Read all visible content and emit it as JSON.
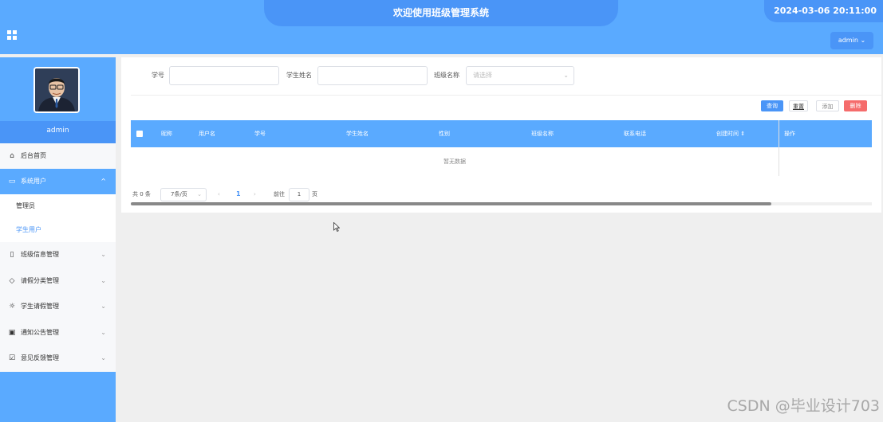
{
  "header": {
    "title": "欢迎使用班级管理系统",
    "datetime": "2024-03-06 20:11:00",
    "user_button": "admin",
    "menu_icon": "grid-icon"
  },
  "sidebar": {
    "username": "admin",
    "items": [
      {
        "label": "后台首页",
        "icon": "home-icon",
        "active": false
      },
      {
        "label": "系统用户",
        "icon": "monitor-icon",
        "active": true,
        "expanded": true,
        "children": [
          {
            "label": "管理员",
            "active": false
          },
          {
            "label": "学生用户",
            "active": true
          }
        ]
      },
      {
        "label": "班级信息管理",
        "icon": "bookmark-icon"
      },
      {
        "label": "请假分类管理",
        "icon": "tag-icon"
      },
      {
        "label": "学生请假管理",
        "icon": "sun-icon"
      },
      {
        "label": "通知公告管理",
        "icon": "inbox-icon"
      },
      {
        "label": "意见反馈管理",
        "icon": "clipboard-icon"
      }
    ]
  },
  "search": {
    "student_no_label": "学号",
    "student_no_value": "",
    "student_name_label": "学生姓名",
    "student_name_value": "",
    "class_label": "班级名称",
    "class_placeholder": "请选择"
  },
  "actions": {
    "query": "查询",
    "reset": "重置",
    "add": "添加",
    "delete": "删除"
  },
  "table": {
    "columns": [
      "昵称",
      "用户名",
      "学号",
      "学生姓名",
      "性别",
      "班级名称",
      "联系电话",
      "创建时间"
    ],
    "operation_column": "操作",
    "empty_text": "暂无数据",
    "rows": []
  },
  "pagination": {
    "total": "共 0 条",
    "page_size": "7条/页",
    "current_page": "1",
    "goto_label": "前往",
    "goto_value": "1",
    "page_suffix": "页"
  },
  "watermark": "CSDN @毕业设计703",
  "colors": {
    "primary": "#5aaaff",
    "primary_dark": "#4a95f7",
    "danger": "#f56c6c"
  }
}
